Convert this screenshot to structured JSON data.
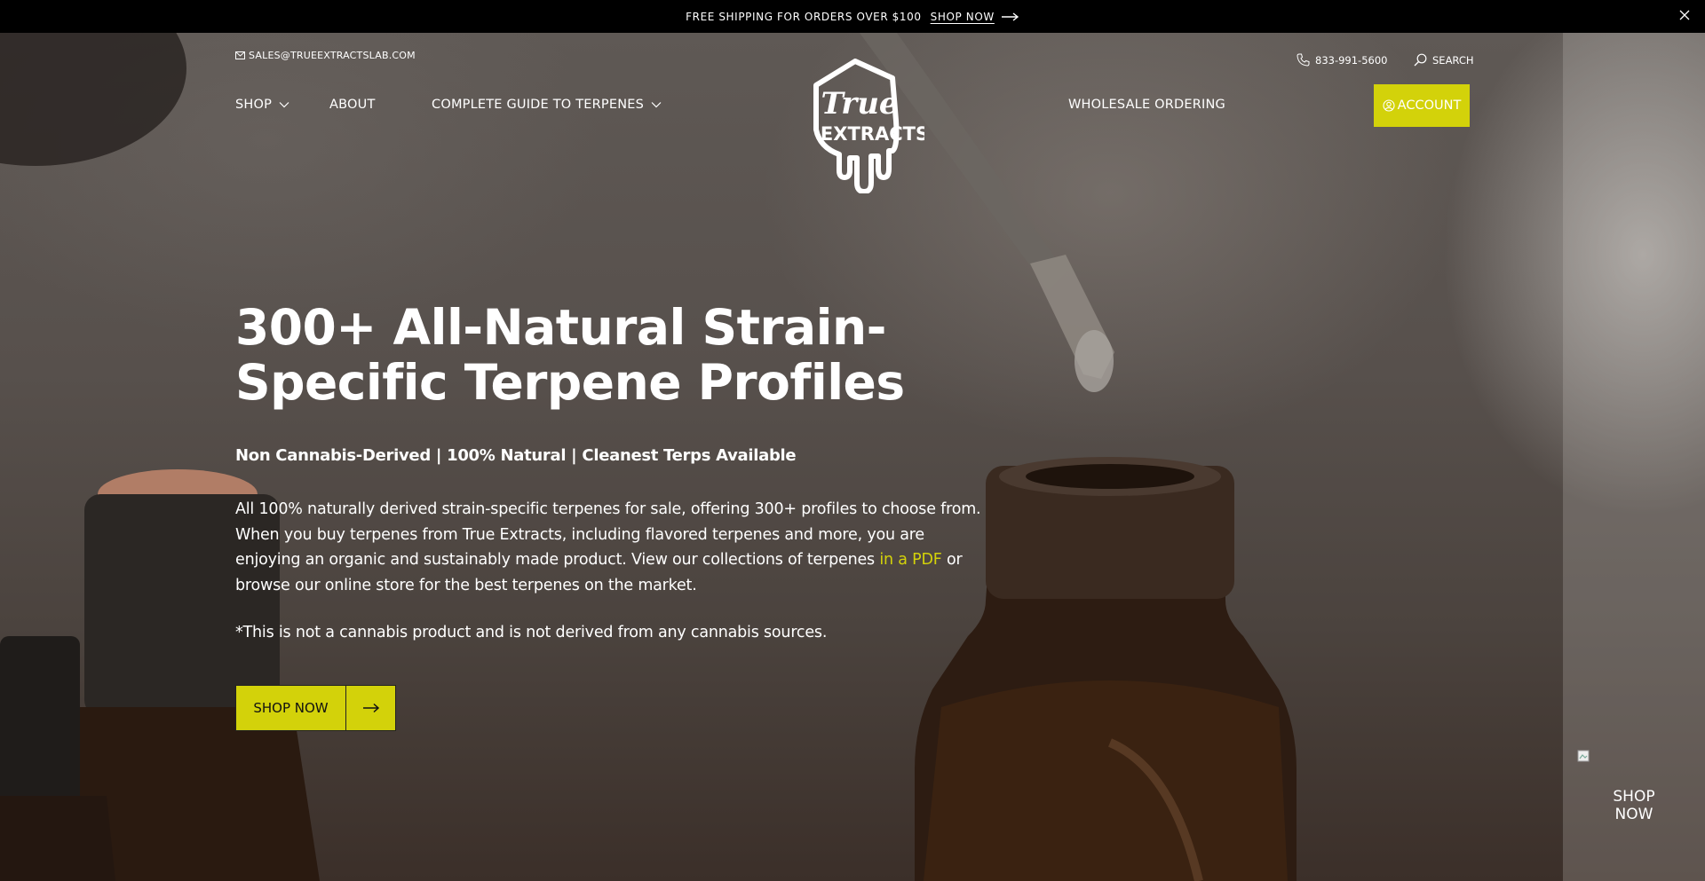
{
  "announcement": {
    "message": "FREE SHIPPING FOR ORDERS OVER $100",
    "link_label": "SHOP NOW"
  },
  "header": {
    "email": "SALES@TRUEEXTRACTSLAB.COM",
    "phone": "833-991-5600",
    "search_label": "SEARCH",
    "nav": [
      {
        "label": "SHOP",
        "dropdown": true
      },
      {
        "label": "ABOUT",
        "dropdown": false
      },
      {
        "label": "COMPLETE GUIDE TO TERPENES",
        "dropdown": true
      },
      {
        "label": "WHOLESALE ORDERING",
        "dropdown": false
      }
    ],
    "account_label": "ACCOUNT",
    "logo": {
      "line1": "True",
      "line2": "EXTRACTS"
    }
  },
  "hero": {
    "headline": "300+ All-Natural Strain-Specific Terpene Profiles",
    "subhead": "Non Cannabis-Derived | 100% Natural | Cleanest Terps Available",
    "body_before_link": "All 100% naturally derived strain-specific terpenes for sale, offering 300+ profiles to choose from. When you buy terpenes from True Extracts, including flavored terpenes and more, you are enjoying an organic and sustainably made product. View our collections of terpenes ",
    "body_link": "in a PDF",
    "body_after_link": " or browse our online store for the best terpenes on the market.",
    "disclaimer": "*This is not a cannabis product and is not derived from any cannabis sources.",
    "cta_label": "SHOP NOW"
  },
  "floating": {
    "shop_now_label": "SHOP NOW"
  },
  "colors": {
    "accent": "#d3d20a",
    "announcement_bg": "#000000"
  },
  "icons": [
    "envelope-icon",
    "phone-icon",
    "search-icon",
    "chevron-down-icon",
    "user-circle-icon",
    "arrow-right-icon",
    "close-icon"
  ]
}
